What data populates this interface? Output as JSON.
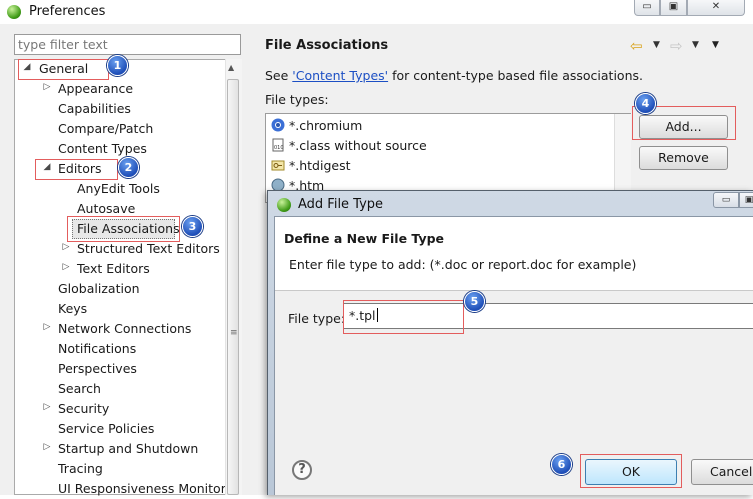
{
  "window": {
    "title": "Preferences",
    "min_glyph": "▭",
    "max_glyph": "▣",
    "close_glyph": "✕"
  },
  "filter": {
    "placeholder": "type filter text"
  },
  "tree": {
    "items": [
      {
        "label": "General",
        "arrow": "◢"
      },
      {
        "label": "Appearance",
        "arrow": "▷"
      },
      {
        "label": "Capabilities"
      },
      {
        "label": "Compare/Patch"
      },
      {
        "label": "Content Types"
      },
      {
        "label": "Editors",
        "arrow": "◢"
      },
      {
        "label": "AnyEdit Tools"
      },
      {
        "label": "Autosave"
      },
      {
        "label": "File Associations"
      },
      {
        "label": "Structured Text Editors",
        "arrow": "▷"
      },
      {
        "label": "Text Editors",
        "arrow": "▷"
      },
      {
        "label": "Globalization"
      },
      {
        "label": "Keys"
      },
      {
        "label": "Network Connections",
        "arrow": "▷"
      },
      {
        "label": "Notifications"
      },
      {
        "label": "Perspectives"
      },
      {
        "label": "Search"
      },
      {
        "label": "Security",
        "arrow": "▷"
      },
      {
        "label": "Service Policies"
      },
      {
        "label": "Startup and Shutdown",
        "arrow": "▷"
      },
      {
        "label": "Tracing"
      },
      {
        "label": "UI Responsiveness Monitoring"
      }
    ],
    "scroll_up": "▲",
    "grip": "≡"
  },
  "badges": [
    "1",
    "2",
    "3",
    "4",
    "5",
    "6"
  ],
  "panel": {
    "title": "File Associations",
    "nav_back": "⇦",
    "nav_fwd": "⇨",
    "drop": "▼",
    "see_prefix": "See ",
    "see_link": "'Content Types'",
    "see_suffix": " for content-type based file associations.",
    "file_types_label": "File types:",
    "file_types": [
      {
        "label": "*.chromium",
        "icon": "chromium-icon"
      },
      {
        "label": "*.class without source",
        "icon": "class-file-icon"
      },
      {
        "label": "*.htdigest",
        "icon": "key-file-icon"
      },
      {
        "label": "*.htm",
        "icon": "globe-icon"
      }
    ],
    "add_label": "Add...",
    "remove_label": "Remove"
  },
  "dialog": {
    "title": "Add File Type",
    "heading": "Define a New File Type",
    "message": "Enter file type to add: (*.doc or report.doc for example)",
    "file_type_label": "File type:",
    "file_type_value": "*.tpl",
    "help_glyph": "?",
    "ok_label": "OK",
    "cancel_label": "Cancel",
    "min_glyph": "▭",
    "max_glyph": "▣"
  },
  "colors": {
    "highlight_box": "#e35d5d",
    "badge": "#1f4fb8",
    "link": "#1c4fc4",
    "ok_border": "#3c7fb1"
  }
}
